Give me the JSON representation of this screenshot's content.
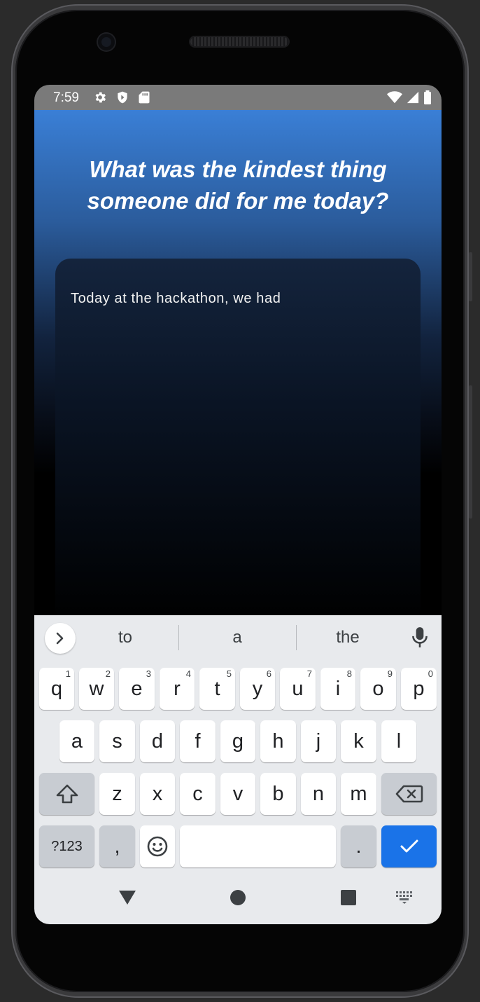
{
  "status_bar": {
    "time": "7:59",
    "icons_left": [
      "gear-icon",
      "shield-icon",
      "sd-card-icon"
    ],
    "icons_right": [
      "wifi-icon",
      "signal-icon",
      "battery-icon"
    ]
  },
  "app": {
    "prompt": "What was the kindest thing someone did for me today?",
    "journal_text": "Today at the hackathon, we had"
  },
  "keyboard": {
    "suggestions": [
      "to",
      "a",
      "the"
    ],
    "row1": [
      {
        "label": "q",
        "hint": "1"
      },
      {
        "label": "w",
        "hint": "2"
      },
      {
        "label": "e",
        "hint": "3"
      },
      {
        "label": "r",
        "hint": "4"
      },
      {
        "label": "t",
        "hint": "5"
      },
      {
        "label": "y",
        "hint": "6"
      },
      {
        "label": "u",
        "hint": "7"
      },
      {
        "label": "i",
        "hint": "8"
      },
      {
        "label": "o",
        "hint": "9"
      },
      {
        "label": "p",
        "hint": "0"
      }
    ],
    "row2": [
      "a",
      "s",
      "d",
      "f",
      "g",
      "h",
      "j",
      "k",
      "l"
    ],
    "row3": [
      "z",
      "x",
      "c",
      "v",
      "b",
      "n",
      "m"
    ],
    "symbols_label": "?123",
    "comma_label": ",",
    "period_label": ".",
    "space_label": "",
    "accent_color": "#1a73e8"
  },
  "navigation": {
    "icons": [
      "back-icon",
      "home-icon",
      "recents-icon",
      "keyboard-switch-icon"
    ]
  }
}
